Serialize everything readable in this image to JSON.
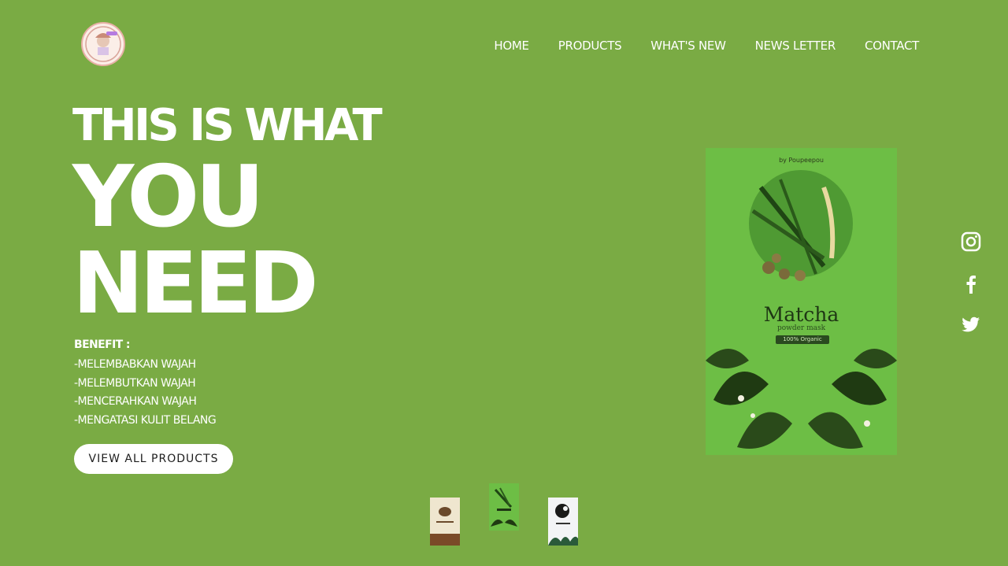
{
  "header": {
    "logo_icon": "brand-logo-icon",
    "nav": [
      {
        "label": "HOME"
      },
      {
        "label": "PRODUCTS"
      },
      {
        "label": "WHAT'S NEW"
      },
      {
        "label": "NEWS LETTER"
      },
      {
        "label": "CONTACT"
      }
    ]
  },
  "hero": {
    "line1": "THIS IS WHAT",
    "line2": "YOU",
    "line3": "NEED",
    "benefit_title": "BENEFIT :",
    "benefits": [
      "-MELEMBABKAN WAJAH",
      "-MELEMBUTKAN WAJAH",
      "-MENCERAHKAN WAJAH",
      "-MENGATASI KULIT BELANG"
    ],
    "cta_label": "VIEW ALL PRODUCTS"
  },
  "product": {
    "brand": "by Poupeepou",
    "name": "Matcha",
    "subtitle": "powder mask",
    "tag": "100% Organic"
  },
  "social": [
    "instagram-icon",
    "facebook-icon",
    "twitter-icon"
  ],
  "thumbnails": [
    {
      "icon": "chocolate-mask-thumb"
    },
    {
      "icon": "matcha-mask-thumb"
    },
    {
      "icon": "charcoal-mask-thumb"
    }
  ],
  "colors": {
    "background": "#7aab44",
    "button_bg": "#ffffff",
    "button_text": "#1d1d1d",
    "product_pack": "#6dbe45"
  }
}
